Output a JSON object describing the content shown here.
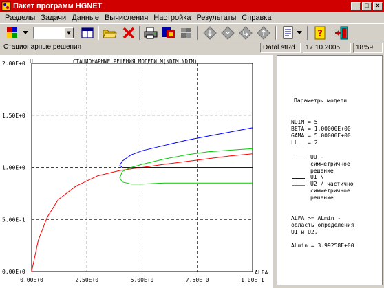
{
  "window": {
    "title": "Пакет программ HGNET",
    "title_color": "#d00000"
  },
  "menu": [
    "Разделы",
    "Задачи",
    "Данные",
    "Вычисления",
    "Настройка",
    "Результаты",
    "Справка"
  ],
  "toolbar": {
    "icons": [
      "palette-icon",
      "window-icon",
      "folder-open-icon",
      "close-x-icon",
      "print-icon",
      "export-icon",
      "grid-icon",
      "nav-down-icon",
      "nav-left-icon",
      "nav-enter-icon",
      "nav-up-icon",
      "document-icon",
      "help-icon",
      "exit-door-icon"
    ],
    "combo_value": ""
  },
  "status": {
    "mode": "Стационарные решения",
    "file": "Datal.stRd",
    "date": "17.10.2005",
    "time": "18:59"
  },
  "plot": {
    "title": "СТАЦИОНАРНЫЕ РЕШЕНИЯ МОДЕЛИ M(NDIM,NDIM)",
    "y_axis_label": "U",
    "x_axis_label": "ALFA",
    "y_ticks": [
      "2.00E+0",
      "1.50E+0",
      "1.00E+0",
      "5.00E-1",
      "0.00E+0"
    ],
    "x_ticks": [
      "0.00E+0",
      "2.50E+0",
      "5.00E+0",
      "7.50E+0",
      "1.00E+1"
    ]
  },
  "info": {
    "header": "Параметры модели",
    "params": [
      "NDIM = 5",
      "BETA = 1.00000E+00",
      "GAMA = 5.00000E+00",
      "LL   = 2"
    ],
    "legend": [
      {
        "color": "#ff0000",
        "text": "UU -\nсимметричное\nрешение"
      },
      {
        "color": "#0000ff",
        "text": "U1 \\"
      },
      {
        "color": "#00cc00",
        "text": "U2 / частично\nсимметричное\nрешение"
      }
    ],
    "note": "ALFA >= ALmin -\nобласть определения\nU1 и U2,",
    "almin": "ALmin = 3.99258E+00"
  },
  "chart_data": {
    "type": "line",
    "title": "СТАЦИОНАРНЫЕ РЕШЕНИЯ МОДЕЛИ M(NDIM,NDIM)",
    "xlabel": "ALFA",
    "ylabel": "U",
    "xlim": [
      0,
      10
    ],
    "ylim": [
      0,
      2
    ],
    "grid": true,
    "series": [
      {
        "name": "UU",
        "color": "#ff0000",
        "x": [
          0,
          0.3,
          0.7,
          1.2,
          2.0,
          3.0,
          4.0,
          5.0,
          6.0,
          7.5,
          9.0,
          10.0
        ],
        "y": [
          0,
          0.3,
          0.52,
          0.69,
          0.82,
          0.92,
          0.97,
          1.0,
          1.03,
          1.07,
          1.11,
          1.13
        ]
      },
      {
        "name": "U1",
        "color": "#0000ff",
        "x": [
          10.0,
          9.0,
          8.0,
          7.0,
          6.0,
          5.0,
          4.5,
          4.1,
          3.99,
          4.1,
          4.5,
          5.0,
          6.0,
          8.0,
          10.0
        ],
        "y": [
          1.38,
          1.34,
          1.3,
          1.26,
          1.21,
          1.16,
          1.12,
          1.06,
          1.02,
          1.0,
          1.0,
          1.0,
          1.0,
          1.0,
          1.0
        ]
      },
      {
        "name": "U2",
        "color": "#00cc00",
        "x": [
          10.0,
          8.0,
          7.0,
          6.0,
          5.0,
          4.5,
          4.1,
          3.99,
          4.1,
          4.5,
          5.0,
          6.0,
          8.0,
          10.0
        ],
        "y": [
          1.18,
          1.15,
          1.12,
          1.08,
          1.03,
          1.0,
          0.96,
          0.9,
          0.86,
          0.84,
          0.84,
          0.85,
          0.85,
          0.85
        ]
      }
    ]
  }
}
